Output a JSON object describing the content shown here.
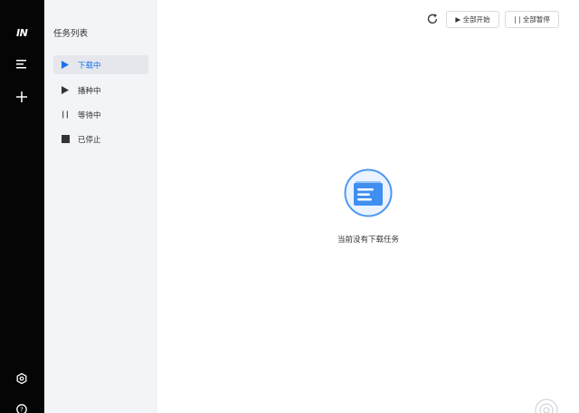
{
  "app": {
    "logo": "IN"
  },
  "rail": {
    "icons": [
      "menu-icon",
      "plus-icon",
      "settings-icon",
      "help-icon"
    ]
  },
  "sidebar": {
    "title": "任务列表",
    "items": [
      {
        "label": "下载中",
        "icon": "play-icon",
        "active": true
      },
      {
        "label": "播种中",
        "icon": "play-icon",
        "active": false
      },
      {
        "label": "等待中",
        "icon": "pause-icon",
        "active": false
      },
      {
        "label": "已停止",
        "icon": "stop-icon",
        "active": false
      }
    ]
  },
  "toolbar": {
    "refresh_icon": "refresh-icon",
    "start_all_label": "▶ 全部开始",
    "pause_all_label": "| | 全部暂停"
  },
  "main": {
    "empty_text": "当前没有下载任务",
    "empty_icon": "empty-list-icon"
  },
  "colors": {
    "accent": "#1a73e8",
    "rail_bg": "#050505",
    "sidebar_bg": "#f3f4f7"
  }
}
